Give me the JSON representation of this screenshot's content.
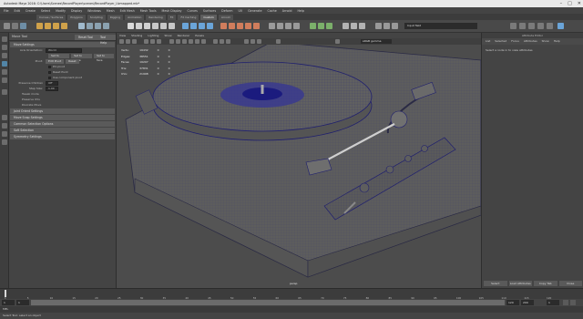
{
  "window": {
    "title": "Autodesk Maya 2016: C:\\Users\\Scenes\\RecordPlayer\\scenes\\RecordPlayer_Uvmapped.mb*",
    "controls": [
      "–",
      "□",
      "✕"
    ]
  },
  "menubar": [
    "File",
    "Edit",
    "Create",
    "Select",
    "Modify",
    "Display",
    "Windows",
    "Mesh",
    "Edit Mesh",
    "Mesh Tools",
    "Mesh Display",
    "Curves",
    "Surfaces",
    "Deform",
    "UV",
    "Generate",
    "Cache",
    "Arnold",
    "Help"
  ],
  "mode_selector": "Modeling",
  "shelf_tabs": [
    {
      "label": "Curves / Surfaces",
      "active": false
    },
    {
      "label": "Polygons",
      "active": false
    },
    {
      "label": "Sculpting",
      "active": false
    },
    {
      "label": "Rigging",
      "active": false
    },
    {
      "label": "Animation",
      "active": false
    },
    {
      "label": "Rendering",
      "active": false
    },
    {
      "label": "FX",
      "active": false
    },
    {
      "label": "FX Caching",
      "active": false
    },
    {
      "label": "Custom",
      "active": true
    },
    {
      "label": "Arnold",
      "active": false
    }
  ],
  "status_line": "Input field",
  "tool_settings": {
    "title": "Move Tool",
    "reset_label": "Reset Tool",
    "help_label": "Tool Help",
    "sections": [
      {
        "label": "Move Settings",
        "open": true
      },
      {
        "label": "Joint Orient Settings",
        "open": false
      },
      {
        "label": "Move Snap Settings",
        "open": false
      },
      {
        "label": "Common Selection Options",
        "open": false
      },
      {
        "label": "Soft Selection",
        "open": false
      },
      {
        "label": "Symmetry Settings",
        "open": false
      }
    ],
    "axis_orientation_label": "Axis Orientation:",
    "axis_orientation_value": "World",
    "axis_buttons": [
      "Set to point",
      "Set to edge",
      "Set to face"
    ],
    "pivot_label": "Pivot:",
    "pivot_buttons": [
      "Edit Pivot",
      "Reset"
    ],
    "pivot_options": [
      "Pin pivot",
      "Reset Pivot",
      "Use component pivot"
    ],
    "tweak_label": "Tweak mode",
    "preserve_label": "Preserve Children",
    "preserve_value": "Off",
    "discrete_label": "Discrete Move",
    "step_label": "Step Size:",
    "step_value": "1.00",
    "reflection_options": [
      "Preserve UVs",
      "Preserve UVs",
      "Tweak Mode"
    ]
  },
  "viewport": {
    "menus": [
      "View",
      "Shading",
      "Lighting",
      "Show",
      "Renderer",
      "Panels"
    ],
    "color_space": "sRGB gamma",
    "stats": [
      [
        "Verts:",
        "19432",
        "0",
        "0"
      ],
      [
        "Edges:",
        "38551",
        "0",
        "0"
      ],
      [
        "Faces:",
        "19207",
        "0",
        "0"
      ],
      [
        "Tris:",
        "37831",
        "0",
        "0"
      ],
      [
        "UVs:",
        "21998",
        "0",
        "0"
      ]
    ],
    "camera": "persp"
  },
  "attribute_editor": {
    "header": "Attribute Editor",
    "tabs": [
      "List",
      "Selected",
      "Focus",
      "Attributes",
      "Show",
      "Help"
    ],
    "message": "Select a node in to view attributes",
    "buttons": [
      "Select",
      "Load Attributes",
      "Copy Tab",
      "Close"
    ]
  },
  "timeline": {
    "ticks": [
      "1",
      "5",
      "10",
      "15",
      "20",
      "25",
      "30",
      "35",
      "40",
      "45",
      "50",
      "55",
      "60",
      "65",
      "70",
      "75",
      "80",
      "85",
      "90",
      "95",
      "100",
      "105",
      "110",
      "115",
      "120"
    ],
    "start": "1",
    "end": "120",
    "range_start": "1",
    "range_end": "120",
    "max_end": "200",
    "current_frame": "1"
  },
  "command_line": {
    "language": "MEL",
    "text": ""
  },
  "help_line": "Select Tool: select an object",
  "colors": {
    "accent": "#5285a6",
    "wire": "#1f1f6e",
    "background": "#444444"
  }
}
